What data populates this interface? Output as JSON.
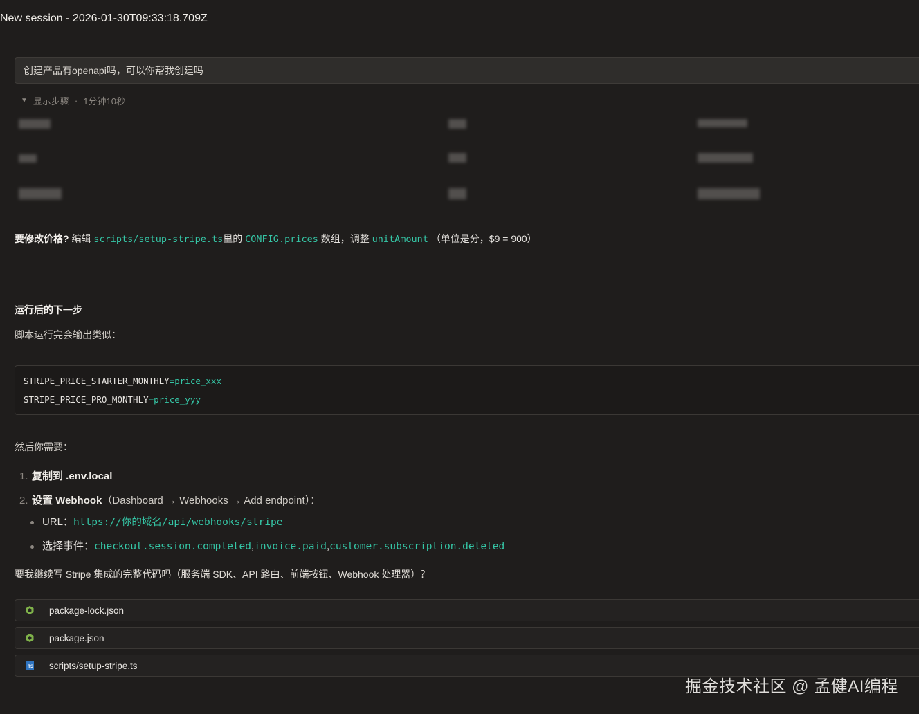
{
  "session": {
    "title": "New session - 2026-01-30T09:33:18.709Z"
  },
  "prompt": {
    "text": "创建产品有openapi吗，可以你帮我创建吗"
  },
  "steps": {
    "label": "显示步骤",
    "separator": "·",
    "duration": "1分钟10秒"
  },
  "price_note": {
    "lead": "要修改价格?",
    "t1": "编辑",
    "file": "scripts/setup-stripe.ts",
    "t2": "里的",
    "config": "CONFIG.prices",
    "t3": "数组，调整",
    "field": "unitAmount",
    "t4": "（单位是分，$9 = 900）"
  },
  "next_steps": {
    "heading": "运行后的下一步",
    "output_intro": "脚本运行完会输出类似："
  },
  "code_block": {
    "lines": [
      {
        "key": "STRIPE_PRICE_STARTER_MONTHLY",
        "eq": "=",
        "value": "price_xxx"
      },
      {
        "key": "STRIPE_PRICE_PRO_MONTHLY",
        "eq": "=",
        "value": "price_yyy"
      }
    ]
  },
  "then": {
    "intro": "然后你需要："
  },
  "ordered_list": [
    {
      "num": "1.",
      "text": "复制到 .env.local"
    },
    {
      "num": "2.",
      "text": "设置 Webhook",
      "detail": "（Dashboard → Webhooks → Add endpoint）："
    }
  ],
  "bullets": {
    "url_label": "URL：",
    "url_value": "https://你的域名/api/webhooks/stripe",
    "events_label": "选择事件：",
    "event1": "checkout.session.completed",
    "event2": "invoice.paid",
    "event3": "customer.subscription.deleted",
    "comma": ","
  },
  "question": {
    "text": "要我继续写 Stripe 集成的完整代码吗（服务端 SDK、API 路由、前端按钮、Webhook 处理器）？"
  },
  "files": [
    {
      "name": "package-lock.json",
      "icon": "nodejs-icon"
    },
    {
      "name": "package.json",
      "icon": "nodejs-icon"
    },
    {
      "name": "scripts/setup-stripe.ts",
      "icon": "typescript-icon"
    }
  ],
  "watermark": {
    "text": "掘金技术社区 @ 孟健AI编程"
  },
  "colors": {
    "background": "#1f1d1c",
    "code_accent": "#35c6a6",
    "node_green": "#7fb24a",
    "ts_blue": "#2f74c0"
  }
}
